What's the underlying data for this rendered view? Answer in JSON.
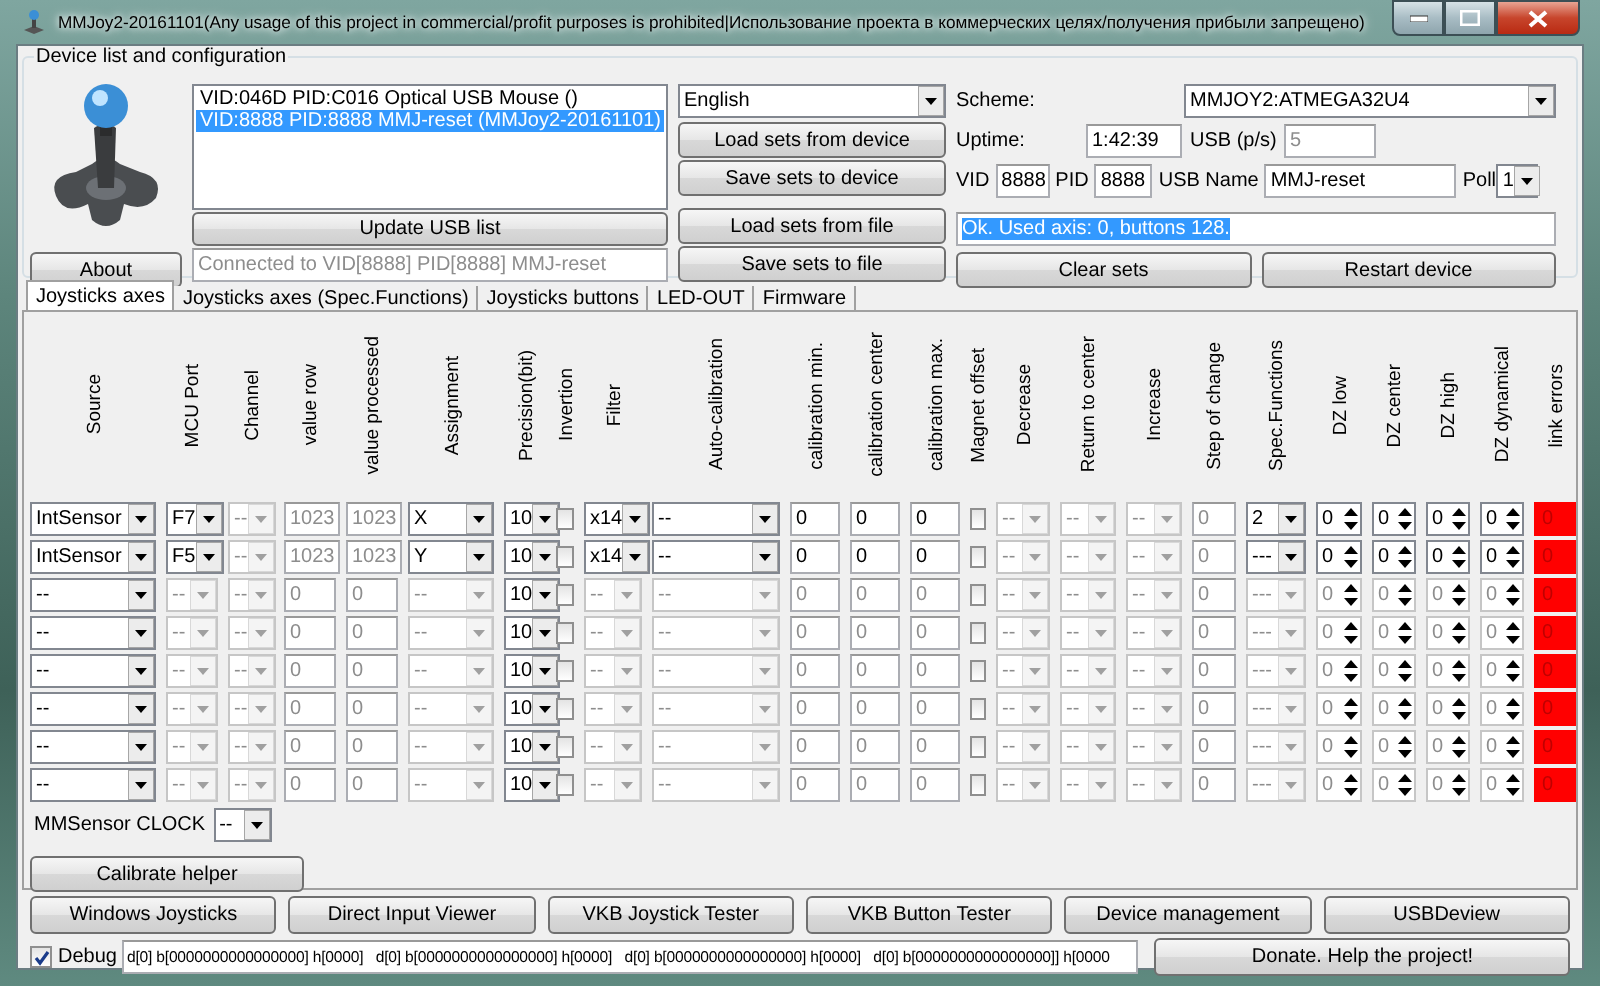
{
  "window": {
    "title": "MMJoy2-20161101(Any usage of this project in commercial/profit purposes is prohibited|Использование проекта в коммерческих целях/получения прибыли запрещено)"
  },
  "device_group": {
    "title": "Device list and configuration",
    "about": "About",
    "devices": [
      {
        "label": "VID:046D PID:C016 Optical USB Mouse ()",
        "selected": false
      },
      {
        "label": "VID:8888 PID:8888 MMJ-reset (MMJoy2-20161101)",
        "selected": true
      }
    ],
    "update_button": "Update USB list",
    "connection": {
      "value": "Connected to VID[8888] PID[8888] MMJ-reset",
      "disabled": true
    },
    "language": "English",
    "file_buttons": [
      "Load sets from device",
      "Save sets to device",
      "Load sets from file",
      "Save sets to file"
    ],
    "scheme_label": "Scheme:",
    "scheme": "MMJOY2:ATMEGA32U4",
    "uptime_label": "Uptime:",
    "uptime": "1:42:39",
    "usb_rate_label": "USB (p/s)",
    "usb_rate": {
      "value": "5",
      "disabled": true
    },
    "vid_label": "VID",
    "vid": "8888",
    "pid_label": "PID",
    "pid": "8888",
    "usb_name_label": "USB Name",
    "usb_name": "MMJ-reset",
    "poll_label": "Poll",
    "poll": "1",
    "status": {
      "text": "Ok. Used axis: 0, buttons 128.",
      "selected": true
    },
    "actions": [
      "Clear sets",
      "Restart device"
    ]
  },
  "tabs": [
    {
      "label": "Joysticks axes",
      "selected": true
    },
    {
      "label": "Joysticks axes (Spec.Functions)",
      "selected": false
    },
    {
      "label": "Joysticks buttons",
      "selected": false
    },
    {
      "label": "LED-OUT",
      "selected": false
    },
    {
      "label": "Firmware",
      "selected": false
    }
  ],
  "axes_table": {
    "columns": [
      {
        "label": "Source",
        "kind": "combo"
      },
      {
        "label": "MCU Port",
        "kind": "combo"
      },
      {
        "label": "Channel",
        "kind": "combo"
      },
      {
        "label": "value row",
        "kind": "field"
      },
      {
        "label": "value processed",
        "kind": "field"
      },
      {
        "label": "Assignment",
        "kind": "combo"
      },
      {
        "label": "Precision(bit)",
        "kind": "combo"
      },
      {
        "label": "Invertion",
        "kind": "check"
      },
      {
        "label": "Filter",
        "kind": "combo"
      },
      {
        "label": "Auto-calibration",
        "kind": "combo"
      },
      {
        "label": "calibration min.",
        "kind": "field"
      },
      {
        "label": "calibration center",
        "kind": "field"
      },
      {
        "label": "calibration max.",
        "kind": "field"
      },
      {
        "label": "Magnet offset",
        "kind": "check"
      },
      {
        "label": "Decrease",
        "kind": "combo"
      },
      {
        "label": "Return to center",
        "kind": "combo"
      },
      {
        "label": "Increase",
        "kind": "combo"
      },
      {
        "label": "Step of change",
        "kind": "field"
      },
      {
        "label": "Spec.Functions",
        "kind": "combo"
      },
      {
        "label": "DZ low",
        "kind": "spin"
      },
      {
        "label": "DZ center",
        "kind": "spin"
      },
      {
        "label": "DZ high",
        "kind": "spin"
      },
      {
        "label": "DZ dynamical",
        "kind": "spin"
      },
      {
        "label": "link errors",
        "kind": "error"
      }
    ],
    "rows": [
      {
        "cells": [
          {
            "value": "IntSensor",
            "disabled": false
          },
          {
            "value": "F7",
            "disabled": false
          },
          {
            "value": "--",
            "disabled": true
          },
          {
            "value": "1023",
            "disabled": true
          },
          {
            "value": "1023",
            "disabled": true
          },
          {
            "value": "X",
            "disabled": false
          },
          {
            "value": "10",
            "disabled": false
          },
          {
            "checked": false
          },
          {
            "value": "x14",
            "disabled": false
          },
          {
            "value": "--",
            "disabled": false
          },
          {
            "value": "0",
            "disabled": false
          },
          {
            "value": "0",
            "disabled": false
          },
          {
            "value": "0",
            "disabled": false
          },
          {
            "checked": false
          },
          {
            "value": "--",
            "disabled": true
          },
          {
            "value": "--",
            "disabled": true
          },
          {
            "value": "--",
            "disabled": true
          },
          {
            "value": "0",
            "disabled": true
          },
          {
            "value": "2",
            "disabled": false
          },
          {
            "value": "0",
            "disabled": false
          },
          {
            "value": "0",
            "disabled": false
          },
          {
            "value": "0",
            "disabled": false
          },
          {
            "value": "0",
            "disabled": false
          },
          {
            "value": "0"
          }
        ]
      },
      {
        "cells": [
          {
            "value": "IntSensor",
            "disabled": false
          },
          {
            "value": "F5",
            "disabled": false
          },
          {
            "value": "--",
            "disabled": true
          },
          {
            "value": "1023",
            "disabled": true
          },
          {
            "value": "1023",
            "disabled": true
          },
          {
            "value": "Y",
            "disabled": false
          },
          {
            "value": "10",
            "disabled": false
          },
          {
            "checked": false
          },
          {
            "value": "x14",
            "disabled": false
          },
          {
            "value": "--",
            "disabled": false
          },
          {
            "value": "0",
            "disabled": false
          },
          {
            "value": "0",
            "disabled": false
          },
          {
            "value": "0",
            "disabled": false
          },
          {
            "checked": false
          },
          {
            "value": "--",
            "disabled": true
          },
          {
            "value": "--",
            "disabled": true
          },
          {
            "value": "--",
            "disabled": true
          },
          {
            "value": "0",
            "disabled": true
          },
          {
            "value": "---",
            "disabled": false
          },
          {
            "value": "0",
            "disabled": false
          },
          {
            "value": "0",
            "disabled": false
          },
          {
            "value": "0",
            "disabled": false
          },
          {
            "value": "0",
            "disabled": false
          },
          {
            "value": "0"
          }
        ]
      },
      {
        "cells": [
          {
            "value": "--",
            "disabled": false
          },
          {
            "value": "--",
            "disabled": true
          },
          {
            "value": "--",
            "disabled": true
          },
          {
            "value": "0",
            "disabled": true
          },
          {
            "value": "0",
            "disabled": true
          },
          {
            "value": "--",
            "disabled": true
          },
          {
            "value": "10",
            "disabled": false
          },
          {
            "checked": false
          },
          {
            "value": "--",
            "disabled": true
          },
          {
            "value": "--",
            "disabled": true
          },
          {
            "value": "0",
            "disabled": true
          },
          {
            "value": "0",
            "disabled": true
          },
          {
            "value": "0",
            "disabled": true
          },
          {
            "checked": false
          },
          {
            "value": "--",
            "disabled": true
          },
          {
            "value": "--",
            "disabled": true
          },
          {
            "value": "--",
            "disabled": true
          },
          {
            "value": "0",
            "disabled": true
          },
          {
            "value": "---",
            "disabled": true
          },
          {
            "value": "0",
            "disabled": true
          },
          {
            "value": "0",
            "disabled": true
          },
          {
            "value": "0",
            "disabled": true
          },
          {
            "value": "0",
            "disabled": true
          },
          {
            "value": "0"
          }
        ]
      },
      {
        "cells": [
          {
            "value": "--",
            "disabled": false
          },
          {
            "value": "--",
            "disabled": true
          },
          {
            "value": "--",
            "disabled": true
          },
          {
            "value": "0",
            "disabled": true
          },
          {
            "value": "0",
            "disabled": true
          },
          {
            "value": "--",
            "disabled": true
          },
          {
            "value": "10",
            "disabled": false
          },
          {
            "checked": false
          },
          {
            "value": "--",
            "disabled": true
          },
          {
            "value": "--",
            "disabled": true
          },
          {
            "value": "0",
            "disabled": true
          },
          {
            "value": "0",
            "disabled": true
          },
          {
            "value": "0",
            "disabled": true
          },
          {
            "checked": false
          },
          {
            "value": "--",
            "disabled": true
          },
          {
            "value": "--",
            "disabled": true
          },
          {
            "value": "--",
            "disabled": true
          },
          {
            "value": "0",
            "disabled": true
          },
          {
            "value": "---",
            "disabled": true
          },
          {
            "value": "0",
            "disabled": true
          },
          {
            "value": "0",
            "disabled": true
          },
          {
            "value": "0",
            "disabled": true
          },
          {
            "value": "0",
            "disabled": true
          },
          {
            "value": "0"
          }
        ]
      },
      {
        "cells": [
          {
            "value": "--",
            "disabled": false
          },
          {
            "value": "--",
            "disabled": true
          },
          {
            "value": "--",
            "disabled": true
          },
          {
            "value": "0",
            "disabled": true
          },
          {
            "value": "0",
            "disabled": true
          },
          {
            "value": "--",
            "disabled": true
          },
          {
            "value": "10",
            "disabled": false
          },
          {
            "checked": false
          },
          {
            "value": "--",
            "disabled": true
          },
          {
            "value": "--",
            "disabled": true
          },
          {
            "value": "0",
            "disabled": true
          },
          {
            "value": "0",
            "disabled": true
          },
          {
            "value": "0",
            "disabled": true
          },
          {
            "checked": false
          },
          {
            "value": "--",
            "disabled": true
          },
          {
            "value": "--",
            "disabled": true
          },
          {
            "value": "--",
            "disabled": true
          },
          {
            "value": "0",
            "disabled": true
          },
          {
            "value": "---",
            "disabled": true
          },
          {
            "value": "0",
            "disabled": true
          },
          {
            "value": "0",
            "disabled": true
          },
          {
            "value": "0",
            "disabled": true
          },
          {
            "value": "0",
            "disabled": true
          },
          {
            "value": "0"
          }
        ]
      },
      {
        "cells": [
          {
            "value": "--",
            "disabled": false
          },
          {
            "value": "--",
            "disabled": true
          },
          {
            "value": "--",
            "disabled": true
          },
          {
            "value": "0",
            "disabled": true
          },
          {
            "value": "0",
            "disabled": true
          },
          {
            "value": "--",
            "disabled": true
          },
          {
            "value": "10",
            "disabled": false
          },
          {
            "checked": false
          },
          {
            "value": "--",
            "disabled": true
          },
          {
            "value": "--",
            "disabled": true
          },
          {
            "value": "0",
            "disabled": true
          },
          {
            "value": "0",
            "disabled": true
          },
          {
            "value": "0",
            "disabled": true
          },
          {
            "checked": false
          },
          {
            "value": "--",
            "disabled": true
          },
          {
            "value": "--",
            "disabled": true
          },
          {
            "value": "--",
            "disabled": true
          },
          {
            "value": "0",
            "disabled": true
          },
          {
            "value": "---",
            "disabled": true
          },
          {
            "value": "0",
            "disabled": true
          },
          {
            "value": "0",
            "disabled": true
          },
          {
            "value": "0",
            "disabled": true
          },
          {
            "value": "0",
            "disabled": true
          },
          {
            "value": "0"
          }
        ]
      },
      {
        "cells": [
          {
            "value": "--",
            "disabled": false
          },
          {
            "value": "--",
            "disabled": true
          },
          {
            "value": "--",
            "disabled": true
          },
          {
            "value": "0",
            "disabled": true
          },
          {
            "value": "0",
            "disabled": true
          },
          {
            "value": "--",
            "disabled": true
          },
          {
            "value": "10",
            "disabled": false
          },
          {
            "checked": false
          },
          {
            "value": "--",
            "disabled": true
          },
          {
            "value": "--",
            "disabled": true
          },
          {
            "value": "0",
            "disabled": true
          },
          {
            "value": "0",
            "disabled": true
          },
          {
            "value": "0",
            "disabled": true
          },
          {
            "checked": false
          },
          {
            "value": "--",
            "disabled": true
          },
          {
            "value": "--",
            "disabled": true
          },
          {
            "value": "--",
            "disabled": true
          },
          {
            "value": "0",
            "disabled": true
          },
          {
            "value": "---",
            "disabled": true
          },
          {
            "value": "0",
            "disabled": true
          },
          {
            "value": "0",
            "disabled": true
          },
          {
            "value": "0",
            "disabled": true
          },
          {
            "value": "0",
            "disabled": true
          },
          {
            "value": "0"
          }
        ]
      },
      {
        "cells": [
          {
            "value": "--",
            "disabled": false
          },
          {
            "value": "--",
            "disabled": true
          },
          {
            "value": "--",
            "disabled": true
          },
          {
            "value": "0",
            "disabled": true
          },
          {
            "value": "0",
            "disabled": true
          },
          {
            "value": "--",
            "disabled": true
          },
          {
            "value": "10",
            "disabled": false
          },
          {
            "checked": false
          },
          {
            "value": "--",
            "disabled": true
          },
          {
            "value": "--",
            "disabled": true
          },
          {
            "value": "0",
            "disabled": true
          },
          {
            "value": "0",
            "disabled": true
          },
          {
            "value": "0",
            "disabled": true
          },
          {
            "checked": false
          },
          {
            "value": "--",
            "disabled": true
          },
          {
            "value": "--",
            "disabled": true
          },
          {
            "value": "--",
            "disabled": true
          },
          {
            "value": "0",
            "disabled": true
          },
          {
            "value": "---",
            "disabled": true
          },
          {
            "value": "0",
            "disabled": true
          },
          {
            "value": "0",
            "disabled": true
          },
          {
            "value": "0",
            "disabled": true
          },
          {
            "value": "0",
            "disabled": true
          },
          {
            "value": "0"
          }
        ]
      }
    ]
  },
  "mmsensor": {
    "label": "MMSensor CLOCK",
    "value": "--"
  },
  "calibrate_button": "Calibrate helper",
  "tool_buttons": [
    "Windows Joysticks",
    "Direct Input Viewer",
    "VKB Joystick Tester",
    "VKB Button Tester",
    "Device management",
    "USBDeview"
  ],
  "debug": {
    "label": "Debug",
    "checked": true,
    "text": "d[0] b[0000000000000000] h[0000]   d[0] b[0000000000000000] h[0000]   d[0] b[0000000000000000] h[0000]   d[0] b[0000000000000000]] h[0000"
  },
  "donate_button": "Donate. Help the project!"
}
